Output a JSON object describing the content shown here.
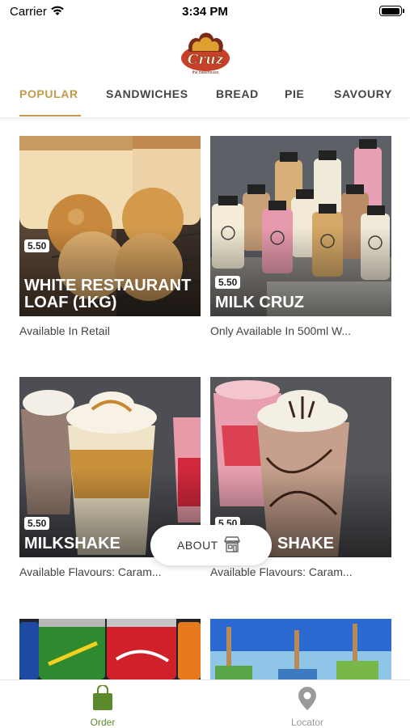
{
  "status_bar": {
    "carrier": "Carrier",
    "time": "3:34 PM"
  },
  "logo": {
    "text": "Cruz",
    "subtext": "the bakehouse"
  },
  "tabs": [
    {
      "label": "POPULAR",
      "active": true
    },
    {
      "label": "SANDWICHES",
      "active": false
    },
    {
      "label": "BREAD",
      "active": false
    },
    {
      "label": "PIE",
      "active": false
    },
    {
      "label": "SAVOURY",
      "active": false
    }
  ],
  "products": [
    {
      "price": "5.50",
      "title": "White Restaurant Loaf (1Kg)",
      "description": "Available In Retail"
    },
    {
      "price": "5.50",
      "title": "Milk Cruz",
      "description": "Only Available In 500ml W..."
    },
    {
      "price": "5.50",
      "title": "Milkshake",
      "description": "Available Flavours: Caram..."
    },
    {
      "price": "5.50",
      "title": "Shake",
      "description": "Available Flavours: Caram..."
    }
  ],
  "about_button": {
    "label": "ABOUT",
    "icon": "store-icon"
  },
  "bottom_nav": [
    {
      "label": "Order",
      "icon": "shopping-bag-icon",
      "active": true
    },
    {
      "label": "Locator",
      "icon": "location-pin-icon",
      "active": false
    }
  ],
  "colors": {
    "accent": "#c49a4a",
    "nav_active": "#5a8a2c",
    "nav_inactive": "#9a9a9a"
  }
}
